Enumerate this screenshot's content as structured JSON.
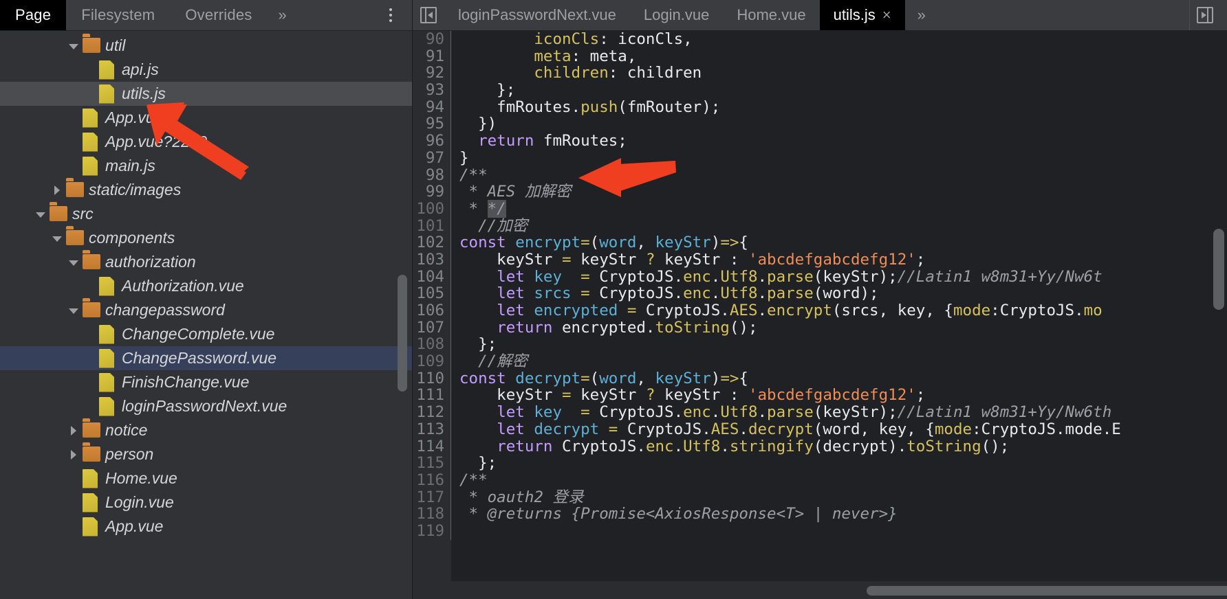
{
  "navigator": {
    "tabs": [
      {
        "label": "Page",
        "selected": true
      },
      {
        "label": "Filesystem",
        "selected": false
      },
      {
        "label": "Overrides",
        "selected": false
      }
    ],
    "more_label": "»",
    "kebab_name": "more-options-icon"
  },
  "file_tree": [
    {
      "label": "util",
      "type": "folder",
      "state": "open",
      "indent": 3,
      "highlight": "none"
    },
    {
      "label": "api.js",
      "type": "file",
      "state": "leaf",
      "indent": 4,
      "highlight": "none"
    },
    {
      "label": "utils.js",
      "type": "file",
      "state": "leaf",
      "indent": 4,
      "highlight": "grey"
    },
    {
      "label": "App.vue",
      "type": "file",
      "state": "leaf",
      "indent": 3,
      "highlight": "none"
    },
    {
      "label": "App.vue?2259",
      "type": "file",
      "state": "leaf",
      "indent": 3,
      "highlight": "none"
    },
    {
      "label": "main.js",
      "type": "file",
      "state": "leaf",
      "indent": 3,
      "highlight": "none"
    },
    {
      "label": "static/images",
      "type": "folder",
      "state": "closed",
      "indent": 2,
      "highlight": "none"
    },
    {
      "label": "src",
      "type": "folder",
      "state": "open",
      "indent": 1,
      "highlight": "none"
    },
    {
      "label": "components",
      "type": "folder",
      "state": "open",
      "indent": 2,
      "highlight": "none"
    },
    {
      "label": "authorization",
      "type": "folder",
      "state": "open",
      "indent": 3,
      "highlight": "none"
    },
    {
      "label": "Authorization.vue",
      "type": "file",
      "state": "leaf",
      "indent": 4,
      "highlight": "none"
    },
    {
      "label": "changepassword",
      "type": "folder",
      "state": "open",
      "indent": 3,
      "highlight": "none"
    },
    {
      "label": "ChangeComplete.vue",
      "type": "file",
      "state": "leaf",
      "indent": 4,
      "highlight": "none"
    },
    {
      "label": "ChangePassword.vue",
      "type": "file",
      "state": "leaf",
      "indent": 4,
      "highlight": "blue"
    },
    {
      "label": "FinishChange.vue",
      "type": "file",
      "state": "leaf",
      "indent": 4,
      "highlight": "none"
    },
    {
      "label": "loginPasswordNext.vue",
      "type": "file",
      "state": "leaf",
      "indent": 4,
      "highlight": "none"
    },
    {
      "label": "notice",
      "type": "folder",
      "state": "closed",
      "indent": 3,
      "highlight": "none"
    },
    {
      "label": "person",
      "type": "folder",
      "state": "closed",
      "indent": 3,
      "highlight": "none"
    },
    {
      "label": "Home.vue",
      "type": "file",
      "state": "leaf",
      "indent": 3,
      "highlight": "none"
    },
    {
      "label": "Login.vue",
      "type": "file",
      "state": "leaf",
      "indent": 3,
      "highlight": "none"
    },
    {
      "label": "App.vue",
      "type": "file",
      "state": "leaf",
      "indent": 3,
      "highlight": "none"
    }
  ],
  "editor": {
    "panel_toggle_left_name": "show-navigator-icon",
    "panel_toggle_right_name": "show-drawer-icon",
    "tabs": [
      {
        "label": "loginPasswordNext.vue",
        "active": false,
        "closable": false
      },
      {
        "label": "Login.vue",
        "active": false,
        "closable": false
      },
      {
        "label": "Home.vue",
        "active": false,
        "closable": false
      },
      {
        "label": "utils.js",
        "active": true,
        "closable": true
      }
    ],
    "close_glyph": "×",
    "more_label": "»",
    "first_line_number": 90,
    "lines": [
      {
        "n": 90,
        "dim": true,
        "tokens": [
          {
            "t": "        ",
            "c": "pl"
          },
          {
            "t": "iconCls",
            "c": "prop"
          },
          {
            "t": ": iconCls,",
            "c": "pl"
          }
        ]
      },
      {
        "n": 91,
        "dim": false,
        "tokens": [
          {
            "t": "        ",
            "c": "pl"
          },
          {
            "t": "meta",
            "c": "prop"
          },
          {
            "t": ": meta,",
            "c": "pl"
          }
        ]
      },
      {
        "n": 92,
        "dim": false,
        "tokens": [
          {
            "t": "        ",
            "c": "pl"
          },
          {
            "t": "children",
            "c": "prop"
          },
          {
            "t": ": children",
            "c": "pl"
          }
        ]
      },
      {
        "n": 93,
        "dim": false,
        "tokens": [
          {
            "t": "    };",
            "c": "pl"
          }
        ]
      },
      {
        "n": 94,
        "dim": false,
        "tokens": [
          {
            "t": "    fmRoutes.",
            "c": "pl"
          },
          {
            "t": "push",
            "c": "prop"
          },
          {
            "t": "(fmRouter);",
            "c": "pl"
          }
        ]
      },
      {
        "n": 95,
        "dim": false,
        "tokens": [
          {
            "t": "  })",
            "c": "pl"
          }
        ]
      },
      {
        "n": 96,
        "dim": false,
        "tokens": [
          {
            "t": "  ",
            "c": "pl"
          },
          {
            "t": "return",
            "c": "kw"
          },
          {
            "t": " fmRoutes;",
            "c": "pl"
          }
        ]
      },
      {
        "n": 97,
        "dim": false,
        "tokens": [
          {
            "t": "}",
            "c": "pl"
          }
        ]
      },
      {
        "n": 98,
        "dim": false,
        "tokens": [
          {
            "t": "/**",
            "c": "cmt"
          }
        ]
      },
      {
        "n": 99,
        "dim": false,
        "tokens": [
          {
            "t": " * AES 加解密",
            "c": "cmt"
          }
        ]
      },
      {
        "n": 100,
        "dim": true,
        "tokens": [
          {
            "t": " * ",
            "c": "cmt"
          },
          {
            "t": "*/",
            "c": "cmt-sel"
          }
        ]
      },
      {
        "n": 101,
        "dim": true,
        "tokens": [
          {
            "t": "  //加密",
            "c": "cmt"
          }
        ]
      },
      {
        "n": 102,
        "dim": false,
        "tokens": [
          {
            "t": "const",
            "c": "kw"
          },
          {
            "t": " ",
            "c": "pl"
          },
          {
            "t": "encrypt",
            "c": "var"
          },
          {
            "t": "=",
            "c": "op"
          },
          {
            "t": "(",
            "c": "pl"
          },
          {
            "t": "word",
            "c": "var"
          },
          {
            "t": ", ",
            "c": "pl"
          },
          {
            "t": "keyStr",
            "c": "var"
          },
          {
            "t": ")",
            "c": "pl"
          },
          {
            "t": "=>",
            "c": "op"
          },
          {
            "t": "{",
            "c": "pl"
          }
        ]
      },
      {
        "n": 103,
        "dim": false,
        "tokens": [
          {
            "t": "    keyStr ",
            "c": "pl"
          },
          {
            "t": "=",
            "c": "op"
          },
          {
            "t": " keyStr ",
            "c": "pl"
          },
          {
            "t": "?",
            "c": "op"
          },
          {
            "t": " keyStr : ",
            "c": "pl"
          },
          {
            "t": "'abcdefgabcdefg12'",
            "c": "str"
          },
          {
            "t": ";",
            "c": "pl"
          }
        ]
      },
      {
        "n": 104,
        "dim": false,
        "tokens": [
          {
            "t": "    ",
            "c": "pl"
          },
          {
            "t": "let",
            "c": "kw"
          },
          {
            "t": " ",
            "c": "pl"
          },
          {
            "t": "key",
            "c": "var"
          },
          {
            "t": "  ",
            "c": "pl"
          },
          {
            "t": "=",
            "c": "op"
          },
          {
            "t": " CryptoJS.",
            "c": "pl"
          },
          {
            "t": "enc",
            "c": "prop"
          },
          {
            "t": ".",
            "c": "pl"
          },
          {
            "t": "Utf8",
            "c": "prop"
          },
          {
            "t": ".",
            "c": "pl"
          },
          {
            "t": "parse",
            "c": "prop"
          },
          {
            "t": "(keyStr);",
            "c": "pl"
          },
          {
            "t": "//Latin1 w8m31+Yy/Nw6t",
            "c": "cmt"
          }
        ]
      },
      {
        "n": 105,
        "dim": false,
        "tokens": [
          {
            "t": "    ",
            "c": "pl"
          },
          {
            "t": "let",
            "c": "kw"
          },
          {
            "t": " ",
            "c": "pl"
          },
          {
            "t": "srcs",
            "c": "var"
          },
          {
            "t": " ",
            "c": "pl"
          },
          {
            "t": "=",
            "c": "op"
          },
          {
            "t": " CryptoJS.",
            "c": "pl"
          },
          {
            "t": "enc",
            "c": "prop"
          },
          {
            "t": ".",
            "c": "pl"
          },
          {
            "t": "Utf8",
            "c": "prop"
          },
          {
            "t": ".",
            "c": "pl"
          },
          {
            "t": "parse",
            "c": "prop"
          },
          {
            "t": "(word);",
            "c": "pl"
          }
        ]
      },
      {
        "n": 106,
        "dim": false,
        "tokens": [
          {
            "t": "    ",
            "c": "pl"
          },
          {
            "t": "let",
            "c": "kw"
          },
          {
            "t": " ",
            "c": "pl"
          },
          {
            "t": "encrypted",
            "c": "var"
          },
          {
            "t": " ",
            "c": "pl"
          },
          {
            "t": "=",
            "c": "op"
          },
          {
            "t": " CryptoJS.",
            "c": "pl"
          },
          {
            "t": "AES",
            "c": "prop"
          },
          {
            "t": ".",
            "c": "pl"
          },
          {
            "t": "encrypt",
            "c": "prop"
          },
          {
            "t": "(srcs, key, {",
            "c": "pl"
          },
          {
            "t": "mode",
            "c": "prop"
          },
          {
            "t": ":CryptoJS.",
            "c": "pl"
          },
          {
            "t": "mo",
            "c": "prop"
          }
        ]
      },
      {
        "n": 107,
        "dim": false,
        "tokens": [
          {
            "t": "    ",
            "c": "pl"
          },
          {
            "t": "return",
            "c": "kw"
          },
          {
            "t": " encrypted.",
            "c": "pl"
          },
          {
            "t": "toString",
            "c": "prop"
          },
          {
            "t": "();",
            "c": "pl"
          }
        ]
      },
      {
        "n": 108,
        "dim": true,
        "tokens": [
          {
            "t": "  };",
            "c": "pl"
          }
        ]
      },
      {
        "n": 109,
        "dim": true,
        "tokens": [
          {
            "t": "  //解密",
            "c": "cmt"
          }
        ]
      },
      {
        "n": 110,
        "dim": false,
        "tokens": [
          {
            "t": "const",
            "c": "kw"
          },
          {
            "t": " ",
            "c": "pl"
          },
          {
            "t": "decrypt",
            "c": "var"
          },
          {
            "t": "=",
            "c": "op"
          },
          {
            "t": "(",
            "c": "pl"
          },
          {
            "t": "word",
            "c": "var"
          },
          {
            "t": ", ",
            "c": "pl"
          },
          {
            "t": "keyStr",
            "c": "var"
          },
          {
            "t": ")",
            "c": "pl"
          },
          {
            "t": "=>",
            "c": "op"
          },
          {
            "t": "{",
            "c": "pl"
          }
        ]
      },
      {
        "n": 111,
        "dim": false,
        "tokens": [
          {
            "t": "    keyStr ",
            "c": "pl"
          },
          {
            "t": "=",
            "c": "op"
          },
          {
            "t": " keyStr ",
            "c": "pl"
          },
          {
            "t": "?",
            "c": "op"
          },
          {
            "t": " keyStr : ",
            "c": "pl"
          },
          {
            "t": "'abcdefgabcdefg12'",
            "c": "str"
          },
          {
            "t": ";",
            "c": "pl"
          }
        ]
      },
      {
        "n": 112,
        "dim": false,
        "tokens": [
          {
            "t": "    ",
            "c": "pl"
          },
          {
            "t": "let",
            "c": "kw"
          },
          {
            "t": " ",
            "c": "pl"
          },
          {
            "t": "key",
            "c": "var"
          },
          {
            "t": "  ",
            "c": "pl"
          },
          {
            "t": "=",
            "c": "op"
          },
          {
            "t": " CryptoJS.",
            "c": "pl"
          },
          {
            "t": "enc",
            "c": "prop"
          },
          {
            "t": ".",
            "c": "pl"
          },
          {
            "t": "Utf8",
            "c": "prop"
          },
          {
            "t": ".",
            "c": "pl"
          },
          {
            "t": "parse",
            "c": "prop"
          },
          {
            "t": "(keyStr);",
            "c": "pl"
          },
          {
            "t": "//Latin1 w8m31+Yy/Nw6th",
            "c": "cmt"
          }
        ]
      },
      {
        "n": 113,
        "dim": false,
        "tokens": [
          {
            "t": "    ",
            "c": "pl"
          },
          {
            "t": "let",
            "c": "kw"
          },
          {
            "t": " ",
            "c": "pl"
          },
          {
            "t": "decrypt",
            "c": "var"
          },
          {
            "t": " ",
            "c": "pl"
          },
          {
            "t": "=",
            "c": "op"
          },
          {
            "t": " CryptoJS.",
            "c": "pl"
          },
          {
            "t": "AES",
            "c": "prop"
          },
          {
            "t": ".",
            "c": "pl"
          },
          {
            "t": "decrypt",
            "c": "prop"
          },
          {
            "t": "(word, key, {",
            "c": "pl"
          },
          {
            "t": "mode",
            "c": "prop"
          },
          {
            "t": ":CryptoJS.mode.",
            "c": "pl"
          },
          {
            "t": "E",
            "c": "pl"
          }
        ]
      },
      {
        "n": 114,
        "dim": false,
        "tokens": [
          {
            "t": "    ",
            "c": "pl"
          },
          {
            "t": "return",
            "c": "kw"
          },
          {
            "t": " CryptoJS.",
            "c": "pl"
          },
          {
            "t": "enc",
            "c": "prop"
          },
          {
            "t": ".",
            "c": "pl"
          },
          {
            "t": "Utf8",
            "c": "prop"
          },
          {
            "t": ".",
            "c": "pl"
          },
          {
            "t": "stringify",
            "c": "prop"
          },
          {
            "t": "(decrypt).",
            "c": "pl"
          },
          {
            "t": "toString",
            "c": "prop"
          },
          {
            "t": "();",
            "c": "pl"
          }
        ]
      },
      {
        "n": 115,
        "dim": true,
        "tokens": [
          {
            "t": "  };",
            "c": "pl"
          }
        ]
      },
      {
        "n": 116,
        "dim": true,
        "tokens": [
          {
            "t": "/**",
            "c": "cmt"
          }
        ]
      },
      {
        "n": 117,
        "dim": true,
        "tokens": [
          {
            "t": " * oauth2 登录",
            "c": "cmt"
          }
        ]
      },
      {
        "n": 118,
        "dim": true,
        "tokens": [
          {
            "t": " * @returns {Promise<AxiosResponse<T> | never>}",
            "c": "cmt"
          }
        ]
      },
      {
        "n": 119,
        "dim": true,
        "tokens": [
          {
            "t": "",
            "c": "pl"
          }
        ]
      }
    ]
  },
  "annotations": [
    {
      "name": "arrow-to-utils-js",
      "color": "#f03e20"
    },
    {
      "name": "arrow-to-aes-comment",
      "color": "#f03e20"
    }
  ]
}
